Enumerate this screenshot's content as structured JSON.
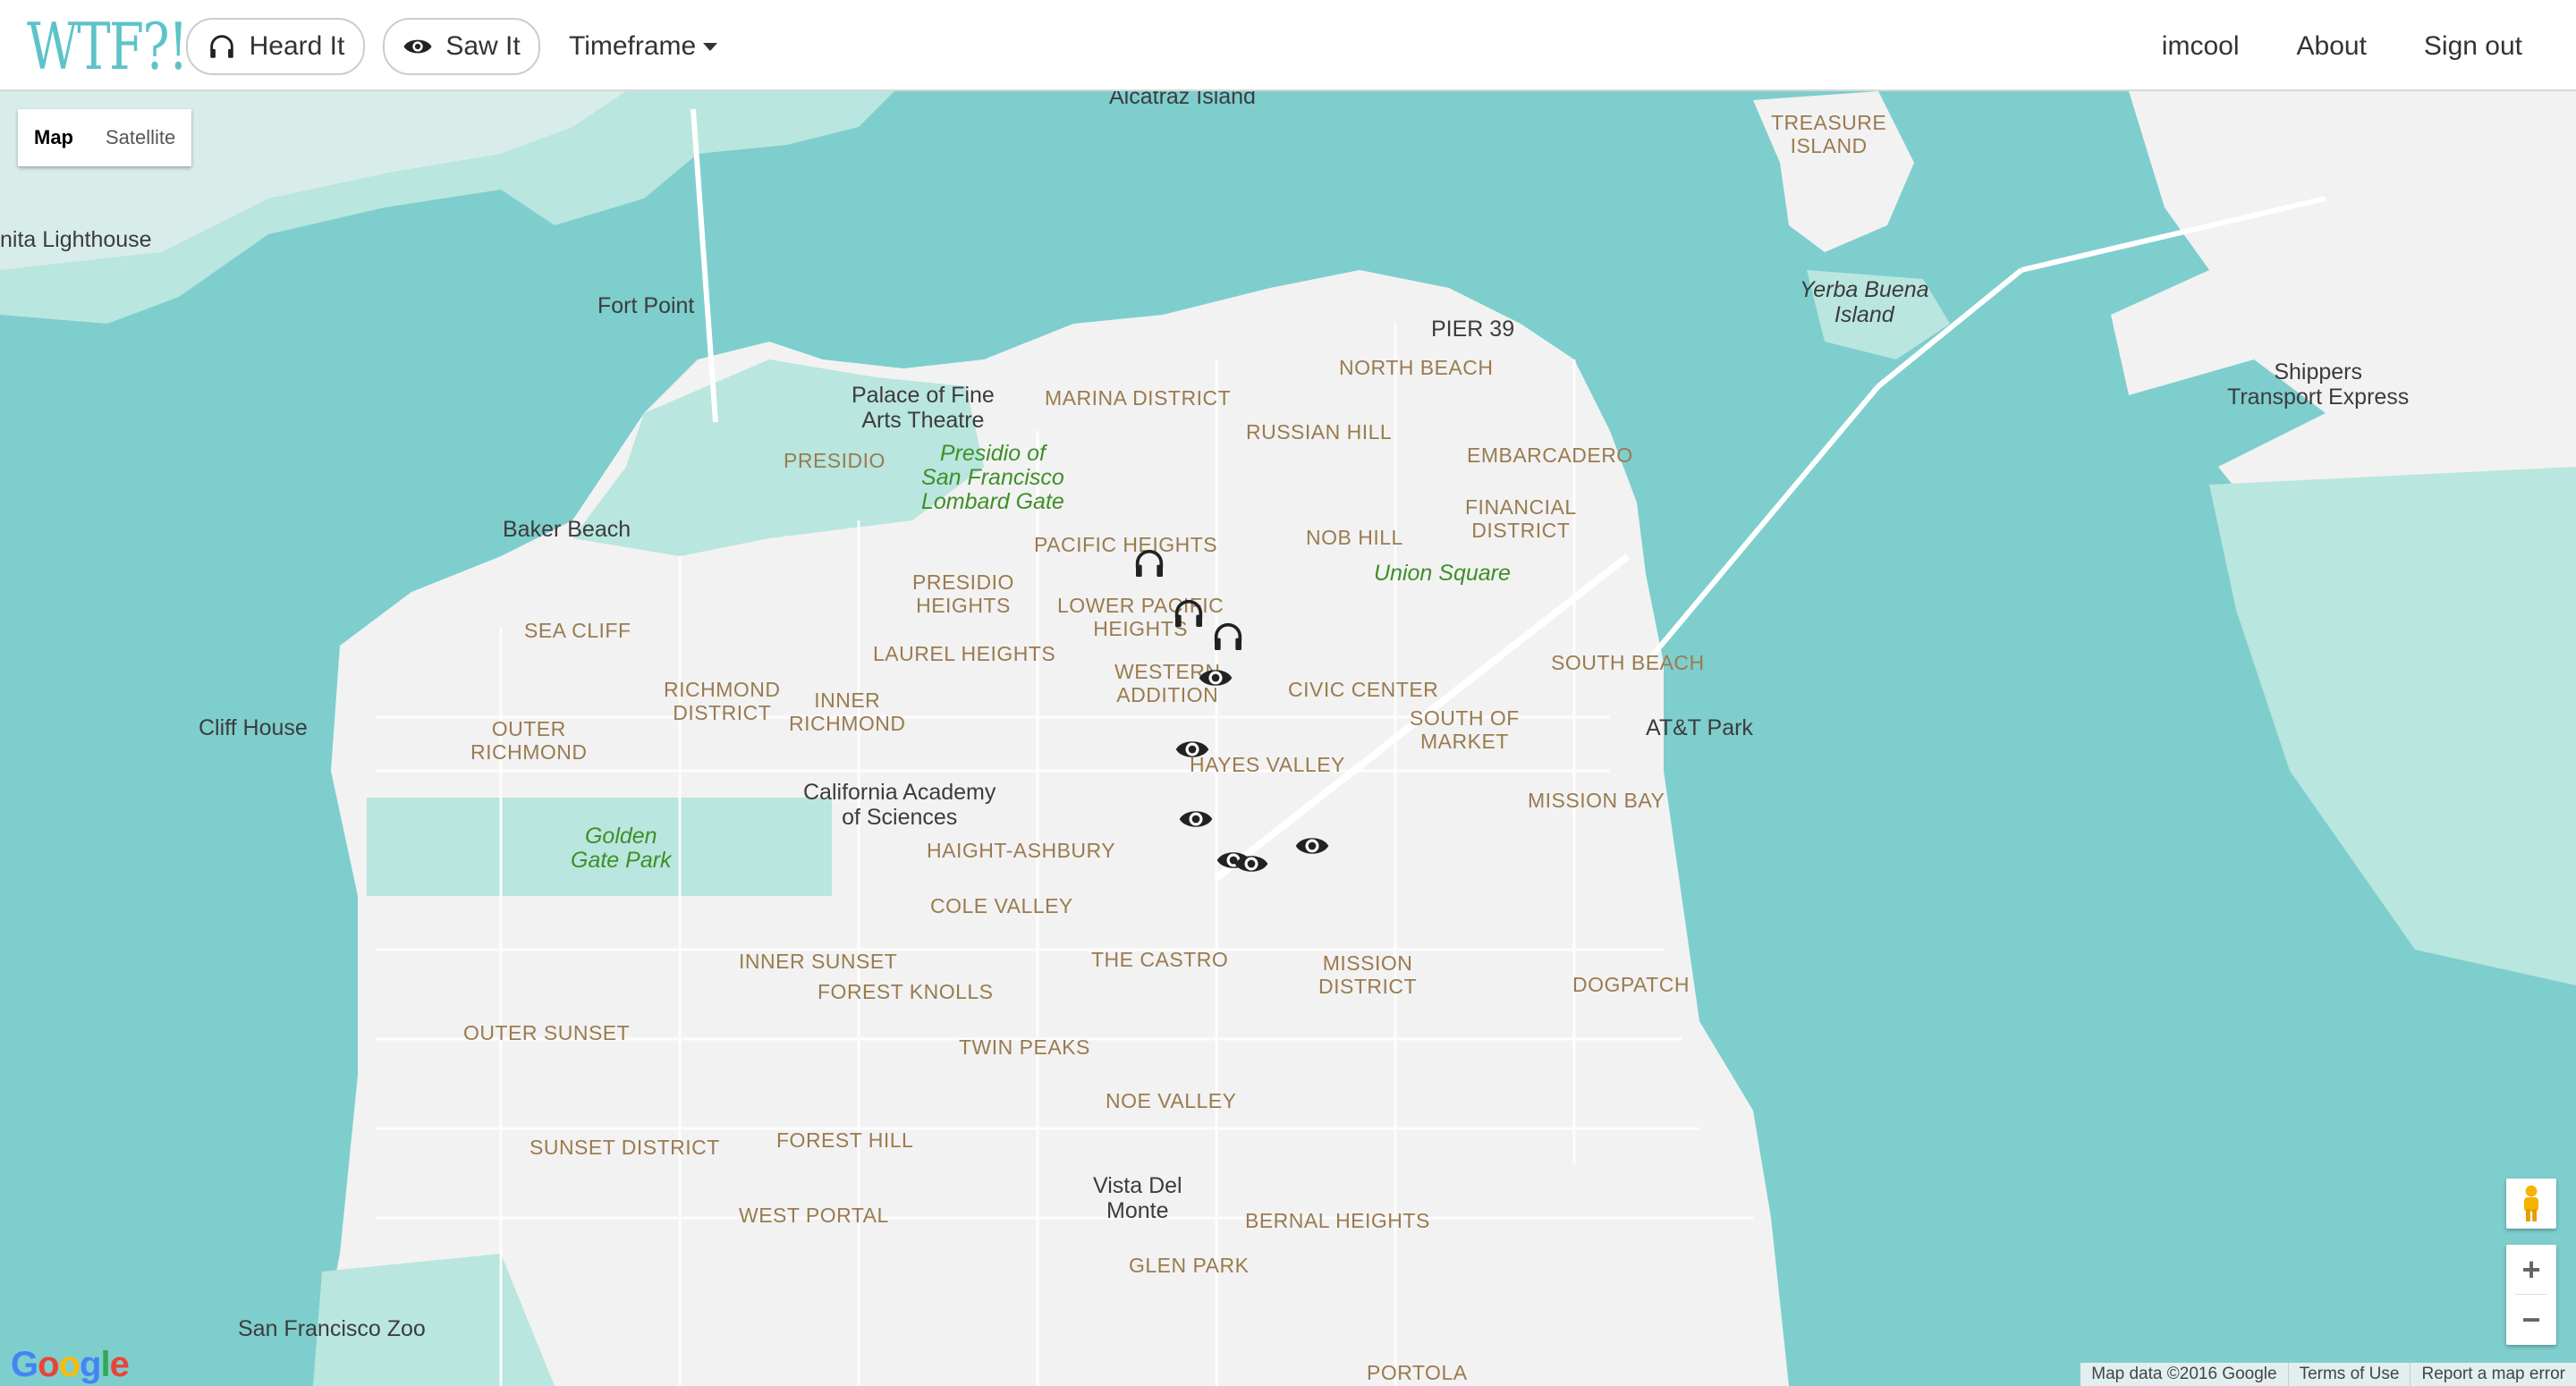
{
  "brand": "WTF?!",
  "nav": {
    "heard_label": "Heard It",
    "saw_label": "Saw It",
    "timeframe_label": "Timeframe",
    "user": "imcool",
    "about": "About",
    "sign_out": "Sign out"
  },
  "map": {
    "type_map": "Map",
    "type_satellite": "Satellite",
    "attribution": "Map data ©2016 Google",
    "terms": "Terms of Use",
    "report": "Report a map error",
    "logo": [
      "G",
      "o",
      "o",
      "g",
      "l",
      "e"
    ],
    "zoom_in": "+",
    "zoom_out": "−",
    "labels": {
      "treasure_island": "TREASURE\nISLAND",
      "yerba_buena": "Yerba Buena\nIsland",
      "pier39": "PIER 39",
      "north_beach": "NORTH BEACH",
      "marina": "MARINA DISTRICT",
      "russian_hill": "RUSSIAN HILL",
      "embarcadero": "EMBARCADERO",
      "financial": "FINANCIAL\nDISTRICT",
      "presidio": "PRESIDIO",
      "pacific_heights": "PACIFIC HEIGHTS",
      "nob_hill": "NOB HILL",
      "presidio_heights": "PRESIDIO\nHEIGHTS",
      "lower_pacific": "LOWER PACIFIC\nHEIGHTS",
      "sea_cliff": "SEA CLIFF",
      "laurel_heights": "LAUREL HEIGHTS",
      "western_addition": "WESTERN\nADDITION",
      "civic_center": "CIVIC CENTER",
      "south_beach": "SOUTH BEACH",
      "richmond_district": "RICHMOND\nDISTRICT",
      "inner_richmond": "INNER\nRICHMOND",
      "south_of_market": "SOUTH OF\nMARKET",
      "outer_richmond": "OUTER\nRICHMOND",
      "hayes_valley": "HAYES VALLEY",
      "mission_bay": "MISSION BAY",
      "haight_ashbury": "HAIGHT-ASHBURY",
      "cole_valley": "COLE VALLEY",
      "inner_sunset": "INNER SUNSET",
      "the_castro": "THE CASTRO",
      "mission_district": "MISSION\nDISTRICT",
      "forest_knolls": "FOREST KNOLLS",
      "dogpatch": "DOGPATCH",
      "outer_sunset": "OUTER SUNSET",
      "twin_peaks": "TWIN PEAKS",
      "noe_valley": "NOE VALLEY",
      "sunset_district": "SUNSET DISTRICT",
      "forest_hill": "FOREST HILL",
      "west_portal": "WEST PORTAL",
      "bernal_heights": "BERNAL HEIGHTS",
      "glen_park": "GLEN PARK",
      "portola": "PORTOLA"
    },
    "pois": {
      "alcatraz": "Alcatraz Island",
      "lighthouse": "nita Lighthouse",
      "fort_point": "Fort Point",
      "palace": "Palace of Fine\nArts Theatre",
      "baker_beach": "Baker Beach",
      "shippers": "Shippers\nTransport Express",
      "cliff_house": "Cliff House",
      "att_park": "AT&T Park",
      "cal_academy": "California Academy\nof Sciences",
      "vista_del_monte": "Vista Del\nMonte",
      "sf_zoo": "San Francisco Zoo"
    },
    "parks": {
      "presidio_lombard": "Presidio of\nSan Francisco\nLombard Gate",
      "union_square": "Union Square",
      "golden_gate_park": "Golden\nGate Park"
    },
    "markers": [
      {
        "kind": "heard"
      },
      {
        "kind": "heard"
      },
      {
        "kind": "heard"
      },
      {
        "kind": "saw"
      },
      {
        "kind": "saw"
      },
      {
        "kind": "saw"
      },
      {
        "kind": "saw"
      },
      {
        "kind": "saw"
      },
      {
        "kind": "saw"
      }
    ]
  },
  "colors": {
    "water": "#7ecece",
    "land": "#f2f2f2",
    "park": "#b9e6de",
    "accent": "#5ec3c8"
  }
}
